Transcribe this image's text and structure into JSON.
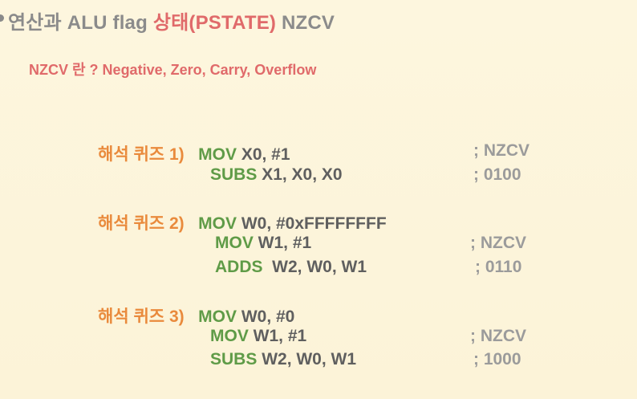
{
  "title": {
    "part1": "연산과 ALU flag ",
    "part2": "상태(PSTATE)",
    "part3": " NZCV"
  },
  "subtitle": "NZCV 란 ? Negative, Zero, Carry, Overflow",
  "quizzes": [
    {
      "label": "해석 퀴즈 1)",
      "lines": [
        {
          "op": "MOV",
          "args": " X0, #1"
        },
        {
          "op": "SUBS",
          "args": " X1, X0, X0"
        }
      ],
      "comments": [
        "; NZCV",
        "; 0100"
      ]
    },
    {
      "label": "해석 퀴즈 2)",
      "lines": [
        {
          "op": "MOV",
          "args": " W0, #0xFFFFFFFF"
        },
        {
          "op": "MOV",
          "args": " W1, #1"
        },
        {
          "op": "ADDS",
          "args": "  W2, W0, W1"
        }
      ],
      "comments": [
        "; NZCV",
        "; 0110"
      ]
    },
    {
      "label": "해석 퀴즈 3)",
      "lines": [
        {
          "op": "MOV",
          "args": " W0, #0"
        },
        {
          "op": "MOV",
          "args": " W1, #1"
        },
        {
          "op": "SUBS",
          "args": " W2, W0, W1"
        }
      ],
      "comments": [
        "; NZCV",
        "; 1000"
      ]
    }
  ],
  "colors": {
    "background": "#fdf5dc",
    "title_gray": "#8b8b8b",
    "title_red": "#e06a6a",
    "quiz_label": "#e98a3c",
    "opcode": "#5f9b47",
    "operands": "#5f5f5f",
    "comment": "#9b9b9b"
  }
}
